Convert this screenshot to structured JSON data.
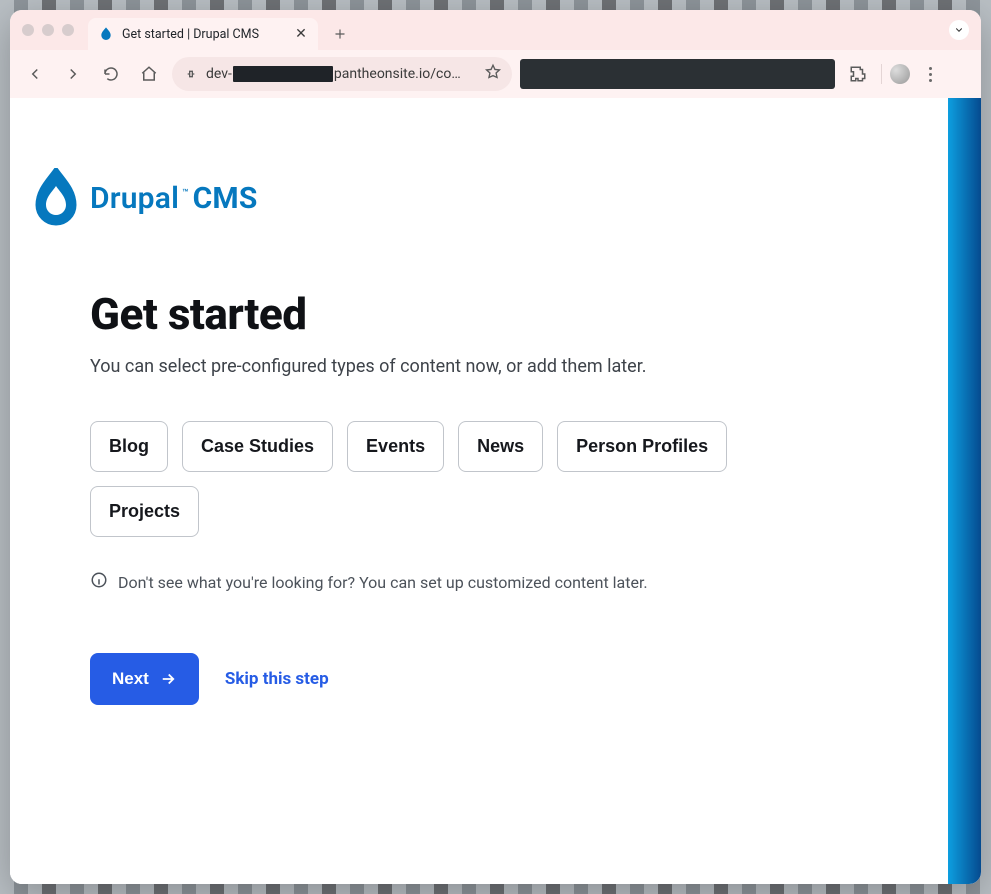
{
  "browser": {
    "tab_title": "Get started | Drupal CMS",
    "url_prefix": "dev-",
    "url_suffix": "pantheonsite.io/co…"
  },
  "brand": {
    "word_a": "Drupal",
    "tm": "™",
    "word_b": "CMS"
  },
  "page": {
    "heading": "Get started",
    "subtitle": "You can select pre-configured types of content now, or add them later.",
    "hint": "Don't see what you're looking for? You can set up customized content later."
  },
  "chips": [
    {
      "label": "Blog"
    },
    {
      "label": "Case Studies"
    },
    {
      "label": "Events"
    },
    {
      "label": "News"
    },
    {
      "label": "Person Profiles"
    },
    {
      "label": "Projects"
    }
  ],
  "actions": {
    "primary": "Next",
    "secondary": "Skip this step"
  }
}
